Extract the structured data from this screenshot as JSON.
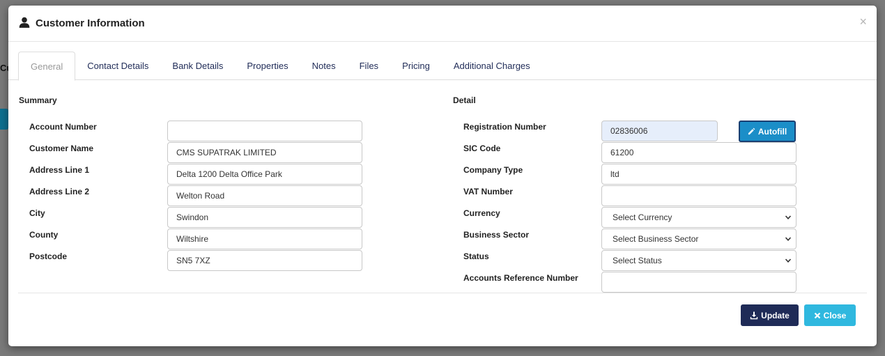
{
  "background": {
    "partial_label": "Cu"
  },
  "modal": {
    "title": "Customer Information",
    "close_glyph": "×"
  },
  "tabs": [
    {
      "label": "General",
      "active": true
    },
    {
      "label": "Contact Details"
    },
    {
      "label": "Bank Details"
    },
    {
      "label": "Properties"
    },
    {
      "label": "Notes"
    },
    {
      "label": "Files"
    },
    {
      "label": "Pricing"
    },
    {
      "label": "Additional Charges"
    }
  ],
  "summary": {
    "title": "Summary",
    "fields": [
      {
        "label": "Account Number",
        "value": ""
      },
      {
        "label": "Customer Name",
        "value": "CMS SUPATRAK LIMITED"
      },
      {
        "label": "Address Line 1",
        "value": "Delta 1200 Delta Office Park"
      },
      {
        "label": "Address Line 2",
        "value": "Welton Road"
      },
      {
        "label": "City",
        "value": "Swindon"
      },
      {
        "label": "County",
        "value": "Wiltshire"
      },
      {
        "label": "Postcode",
        "value": "SN5 7XZ"
      }
    ]
  },
  "detail": {
    "title": "Detail",
    "registration_number": {
      "label": "Registration Number",
      "value": "02836006"
    },
    "sic_code": {
      "label": "SIC Code",
      "value": "61200"
    },
    "company_type": {
      "label": "Company Type",
      "value": "ltd"
    },
    "vat_number": {
      "label": "VAT Number",
      "value": ""
    },
    "currency": {
      "label": "Currency",
      "selected": "Select Currency"
    },
    "business_sector": {
      "label": "Business Sector",
      "selected": "Select Business Sector"
    },
    "status": {
      "label": "Status",
      "selected": "Select Status"
    },
    "accounts_reference": {
      "label": "Accounts Reference Number",
      "value": ""
    }
  },
  "buttons": {
    "autofill": "Autofill",
    "update": "Update",
    "close": "Close"
  },
  "colors": {
    "primary_dark": "#1f2b57",
    "autofill": "#1b8ec8",
    "close": "#2fb8df",
    "highlight_input": "#e6eefb"
  },
  "icons": {
    "header": "user-icon",
    "autofill": "pencil-icon",
    "update": "download-icon",
    "close": "close-icon"
  }
}
